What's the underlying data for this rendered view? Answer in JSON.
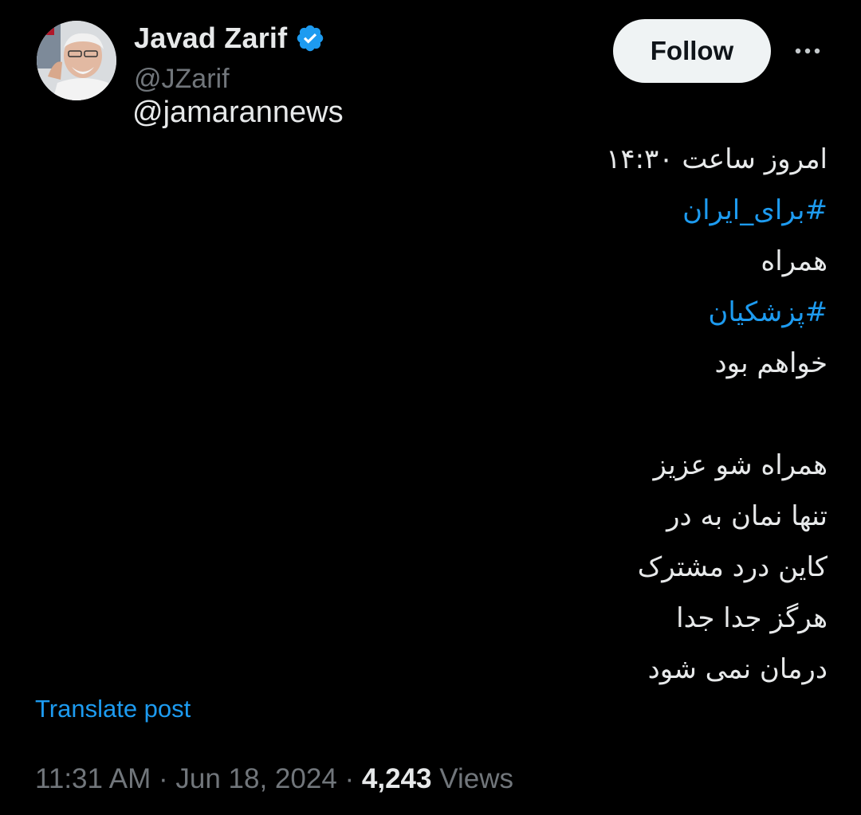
{
  "author": {
    "display_name": "Javad Zarif",
    "handle": "@JZarif",
    "verified": true,
    "verified_color": "#1d9bf0",
    "avatar_icon": "profile-photo"
  },
  "reply_to": "@jamarannews",
  "actions": {
    "follow_label": "Follow",
    "more_icon": "more-horizontal-icon"
  },
  "tweet": {
    "lines": [
      {
        "text": "امروز ساعت ۱۴:۳۰",
        "type": "text"
      },
      {
        "text": "#برای_ایران",
        "type": "hashtag"
      },
      {
        "text": "همراه",
        "type": "text"
      },
      {
        "text": "#پزشکیان",
        "type": "hashtag"
      },
      {
        "text": "خواهم بود",
        "type": "text"
      },
      {
        "text": "",
        "type": "blank"
      },
      {
        "text": "همراه شو عزیز",
        "type": "text"
      },
      {
        "text": "تنها نمان به در",
        "type": "text"
      },
      {
        "text": "کاین درد مشترک",
        "type": "text"
      },
      {
        "text": "هرگز جدا جدا",
        "type": "text"
      },
      {
        "text": "درمان نمی شود",
        "type": "text"
      }
    ]
  },
  "translate_label": "Translate post",
  "meta": {
    "time": "11:31 AM",
    "separator": " · ",
    "date": "Jun 18, 2024",
    "views_count": "4,243",
    "views_label": "Views"
  },
  "colors": {
    "background": "#000000",
    "primary_text": "#e7e9ea",
    "secondary_text": "#71767b",
    "link": "#1d9bf0",
    "follow_bg": "#eff3f4"
  }
}
